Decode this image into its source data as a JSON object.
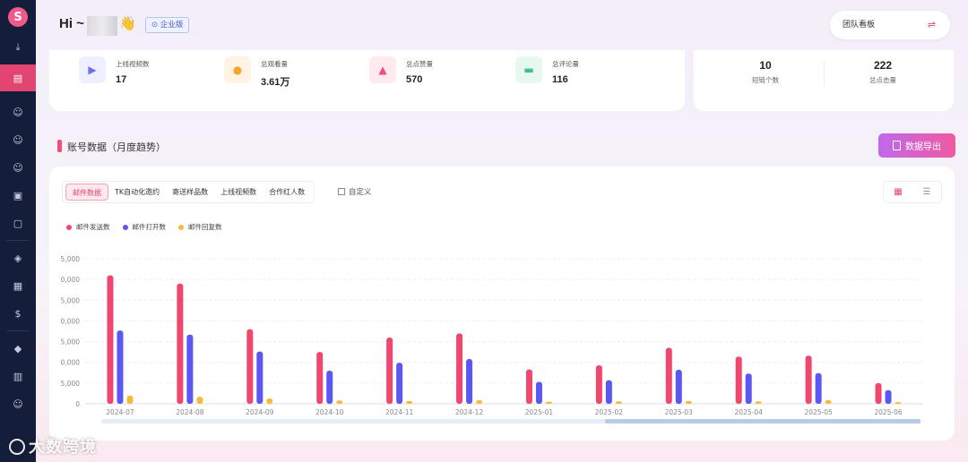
{
  "sidebar": {
    "logo": "S",
    "icons": [
      "download-icon",
      "dashboard-icon",
      "user-icon",
      "user-search-icon",
      "user-add-icon",
      "wallet-icon",
      "contact-card-icon",
      "cube-icon",
      "image-stack-icon",
      "user-money-icon",
      "diamond-icon",
      "bar-chart-icon",
      "person-icon"
    ]
  },
  "header": {
    "greeting": "Hi ~",
    "emoji": "👋",
    "badge": "企业版",
    "team_select": "团队看板",
    "swap_icon": "⇌"
  },
  "stats": [
    {
      "label": "上线视频数",
      "value": "17",
      "icon": "video-icon",
      "color": "#eef0ff"
    },
    {
      "label": "总观看量",
      "value": "3.61万",
      "icon": "eye-icon",
      "color": "#fff3e3"
    },
    {
      "label": "总点赞量",
      "value": "570",
      "icon": "thumb-up-icon",
      "color": "#ffeaef"
    },
    {
      "label": "总评论量",
      "value": "116",
      "icon": "comment-icon",
      "color": "#e6f8ef"
    }
  ],
  "right_stats": [
    {
      "value": "10",
      "label": "短链个数"
    },
    {
      "value": "222",
      "label": "总点击量"
    }
  ],
  "section": {
    "title": "账号数据（月度趋势）",
    "export_label": "数据导出"
  },
  "chart_panel": {
    "tabs": [
      "邮件数据",
      "TK自动化邀约",
      "寄送样品数",
      "上线视频数",
      "合作红人数"
    ],
    "custom_label": "自定义",
    "view_icons": [
      "grid-icon",
      "list-icon"
    ]
  },
  "chart_data": {
    "type": "bar",
    "categories": [
      "2024-07",
      "2024-08",
      "2024-09",
      "2024-10",
      "2024-11",
      "2024-12",
      "2025-01",
      "2025-02",
      "2025-03",
      "2025-04",
      "2025-05",
      "2025-06"
    ],
    "y_tick_labels": [
      "0",
      "5,000",
      "0,000",
      "5,000",
      "0,000",
      "5,000",
      "0,000",
      "5,000"
    ],
    "ylim": [
      0,
      35000
    ],
    "series": [
      {
        "name": "邮件发送数",
        "color": "#f0476e",
        "values": [
          31000,
          29000,
          18000,
          12500,
          16000,
          17000,
          8300,
          9300,
          13500,
          11400,
          11600,
          5000
        ]
      },
      {
        "name": "邮件打开数",
        "color": "#5b57f2",
        "values": [
          17700,
          16700,
          12600,
          8000,
          9900,
          10800,
          5300,
          5700,
          8200,
          7300,
          7400,
          3300
        ]
      },
      {
        "name": "邮件回复数",
        "color": "#f6b93a",
        "values": [
          2000,
          1700,
          1300,
          800,
          700,
          900,
          500,
          600,
          700,
          600,
          900,
          400
        ]
      }
    ],
    "grid": true,
    "legend_position": "top-left"
  },
  "watermark": "大数跨境"
}
